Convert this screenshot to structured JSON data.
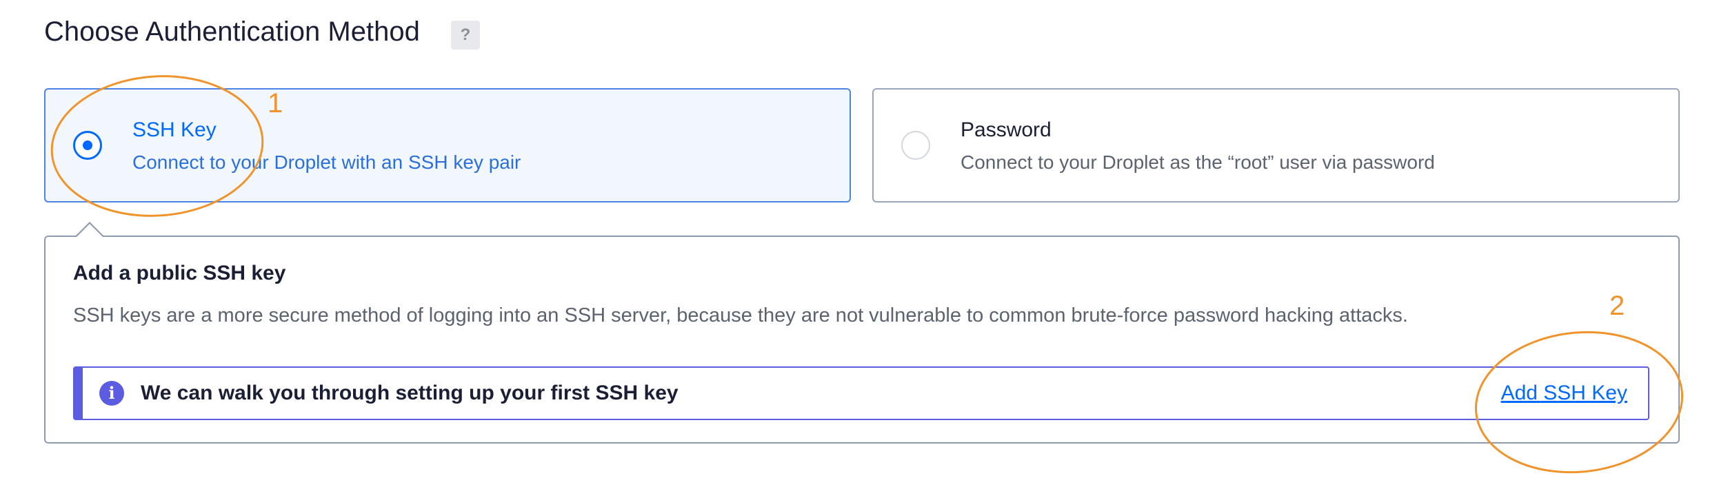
{
  "header": {
    "title": "Choose Authentication Method",
    "help_label": "?"
  },
  "auth_options": {
    "ssh": {
      "title": "SSH Key",
      "description": "Connect to your Droplet with an SSH key pair",
      "selected": true
    },
    "password": {
      "title": "Password",
      "description": "Connect to your Droplet as the “root” user via password",
      "selected": false
    }
  },
  "ssh_panel": {
    "title": "Add a public SSH key",
    "description": "SSH keys are a more secure method of logging into an SSH server, because they are not vulnerable to common brute-force password hacking attacks.",
    "banner": {
      "icon": "info-icon",
      "icon_glyph": "i",
      "text": "We can walk you through setting up your first SSH key",
      "link_label": "Add SSH Key"
    }
  },
  "annotations": {
    "marker_1": "1",
    "marker_2": "2",
    "color": "#f0932b"
  },
  "colors": {
    "accent_blue": "#0069ff",
    "info_purple": "#5b5ce0",
    "selected_card_bg": "#f2f7fe",
    "text_dark": "#1a1f36",
    "text_muted": "#5b6270"
  }
}
